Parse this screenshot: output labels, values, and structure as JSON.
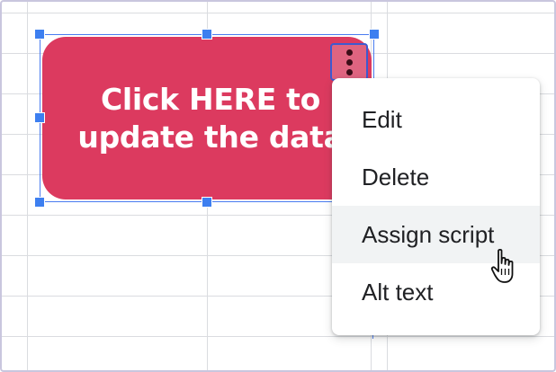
{
  "drawing": {
    "label": "Click HERE to\nupdate the data",
    "color": "#dc3a5f",
    "more_button_icon": "more-vert-icon"
  },
  "context_menu": {
    "items": [
      {
        "label": "Edit"
      },
      {
        "label": "Delete"
      },
      {
        "label": "Assign script"
      },
      {
        "label": "Alt text"
      }
    ],
    "hovered_item": "Assign script"
  },
  "cursor": {
    "icon": "hand-pointer-icon"
  },
  "colors": {
    "selection_handle": "#3d7ff0",
    "grid_line": "#dadce0",
    "menu_hover": "#f1f3f4"
  }
}
